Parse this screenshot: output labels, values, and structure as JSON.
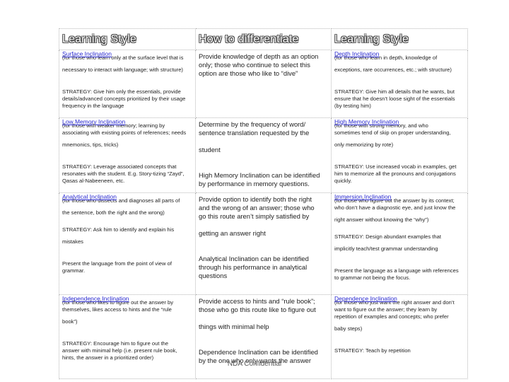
{
  "headers": [
    "Learning Style",
    "How to differentiate",
    "Learning Style"
  ],
  "rows": [
    {
      "left": {
        "title": "Surface Inclination",
        "lines": [
          "(for those who learn only at the surface level that is",
          "",
          "necessary to interact with language; with structure)",
          "",
          "",
          "",
          "STRATEGY: Give him only the essentials, provide",
          "details/advanced concepts prioritized by their usage",
          "frequency in the language"
        ]
      },
      "middle": [
        "Provide knowledge of depth as an option",
        "only; those who continue to select this",
        "option are those who like to “dive”"
      ],
      "right": {
        "title": "Depth Inclination",
        "lines": [
          "(for those who learn in depth, knowledge of",
          "",
          "exceptions, rare occurrences, etc.; with structure)",
          "",
          "",
          "",
          "STRATEGY: Give him all details that he wants, but",
          "ensure that he doesn’t loose sight of the essentials",
          "(by testing him)"
        ]
      }
    },
    {
      "left": {
        "title": "Low Memory Inclination",
        "lines": [
          "(for those with weaker memory; learning by",
          "associating with existing points of references; needs",
          "",
          "mnemonics, tips, tricks)",
          "",
          "",
          "",
          "STRATEGY: Leverage associated concepts that",
          "resonates with the student. E.g. Story-tizing “Zayd”,",
          "Qasas al-Nabeeneen, etc."
        ]
      },
      "middle": [
        "Determine by the frequency of word/",
        "sentence translation requested by the",
        "",
        "student",
        "",
        "",
        "High Memory Inclination can be identified",
        "by performance in memory questions."
      ],
      "right": {
        "title": "High Memory Inclination",
        "lines": [
          "(for those with strong memory, and who",
          "sometimes tend of skip on proper understanding,",
          "",
          "only memorizing by rote)",
          "",
          "",
          "",
          "STRATEGY: Use increased vocab in examples, get",
          "him to memorize all the pronouns and conjugations",
          "quickly."
        ]
      }
    },
    {
      "left": {
        "title": "Analytical Inclination",
        "lines": [
          "(for those who dissects and diagnoses all parts of",
          "",
          "the sentence, both the right and the wrong)",
          "",
          "",
          "STRATEGY: Ask him to identify and explain his",
          "",
          "mistakes",
          "",
          "",
          "",
          "Present the language from the point of view of",
          "grammar."
        ]
      },
      "middle": [
        "Provide option to identify both the right",
        "and the wrong of an answer; those who",
        "go this route aren’t simply satisfied by",
        "",
        "getting an answer right",
        "",
        "",
        "Analytical Inclination can be identified",
        "through his performance in analytical",
        "questions"
      ],
      "right": {
        "title": "Immersion Inclination",
        "lines": [
          "(for those who figure out the answer by its context;",
          "who don’t have a diagnostic eye, and just know the",
          "",
          "right answer without knowing the “why”)",
          "",
          "",
          "STRATEGY: Design abundant examples that",
          "",
          "implicitly teach/test grammar understanding",
          "",
          "",
          "",
          "Present the language as a language with references",
          "to grammar not being the focus."
        ]
      }
    },
    {
      "left": {
        "title": "Independence Inclination",
        "lines": [
          "(for those who likes to figure out the answer by",
          "themselves, likes access to hints and the “rule",
          "",
          "book”)",
          "",
          "",
          "",
          "STRATEGY: Encourage him to figure out the",
          "answer with minimal help (i.e. present  rule book,",
          "hints, the answer in a prioritized order)"
        ]
      },
      "middle": [
        "Provide access to hints and “rule book”;",
        "those who go this route like to figure out",
        "",
        "things with minimal help",
        "",
        "",
        "Dependence Inclination can be identified",
        "by the one who only wants the answer"
      ],
      "right": {
        "title": "Dependence  Inclination",
        "lines": [
          "(for those who just want the right answer and don’t",
          "want to figure out the answer; they learn by",
          "repetition of examples and concepts; who prefer",
          "",
          "baby steps)",
          "",
          "",
          "",
          "STRATEGY: Teach by repetition"
        ]
      }
    }
  ],
  "footer": "NDA Confidential"
}
